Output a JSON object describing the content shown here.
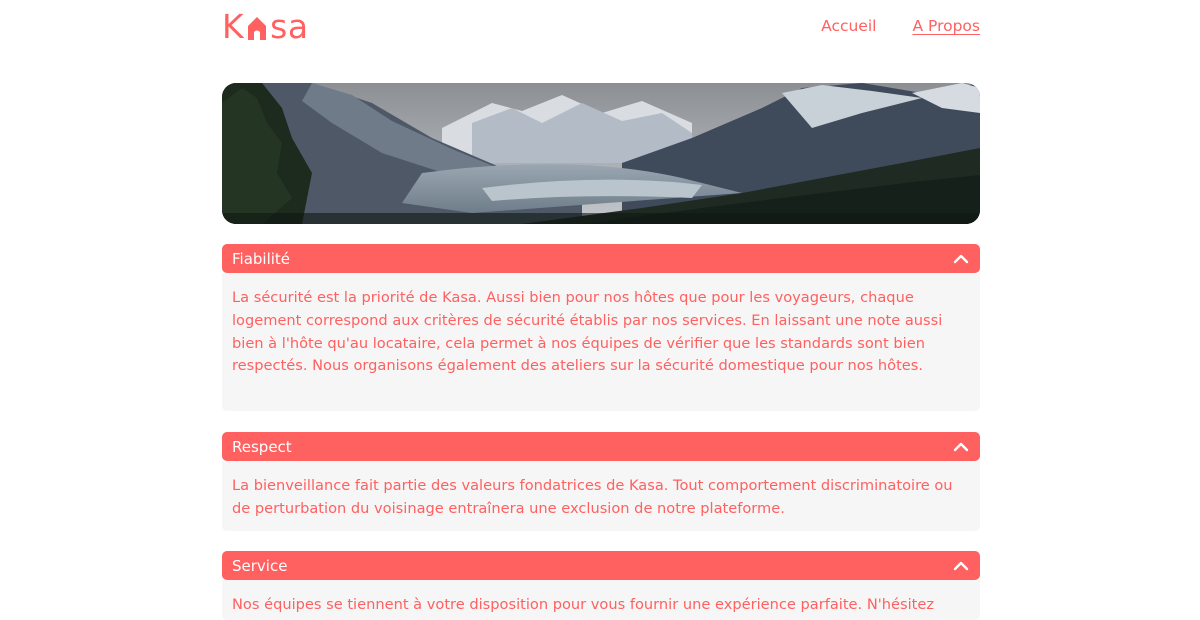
{
  "brand": {
    "name_prefix": "K",
    "name_suffix": "sa",
    "accent_color": "#FF6060",
    "background_color": "#F6F6F6"
  },
  "nav": {
    "items": [
      {
        "label": "Accueil",
        "active": false
      },
      {
        "label": "A Propos",
        "active": true
      }
    ]
  },
  "banner": {
    "icon": "mountain-landscape-image"
  },
  "sections": [
    {
      "title": "Fiabilité",
      "expanded": true,
      "text": "La sécurité est la priorité de Kasa. Aussi bien pour nos hôtes que pour les voyageurs, chaque logement correspond aux critères de sécurité établis par nos services. En laissant une note aussi bien à l'hôte qu'au locataire, cela permet à nos équipes de vérifier que les standards sont bien respectés. Nous organisons également des ateliers sur la sécurité domestique pour nos hôtes."
    },
    {
      "title": "Respect",
      "expanded": true,
      "text": "La bienveillance fait partie des valeurs fondatrices de Kasa. Tout comportement discriminatoire ou de perturbation du voisinage entraînera une exclusion de notre plateforme."
    },
    {
      "title": "Service",
      "expanded": true,
      "text": "Nos équipes se tiennent à votre disposition pour vous fournir une expérience parfaite. N'hésitez"
    }
  ]
}
